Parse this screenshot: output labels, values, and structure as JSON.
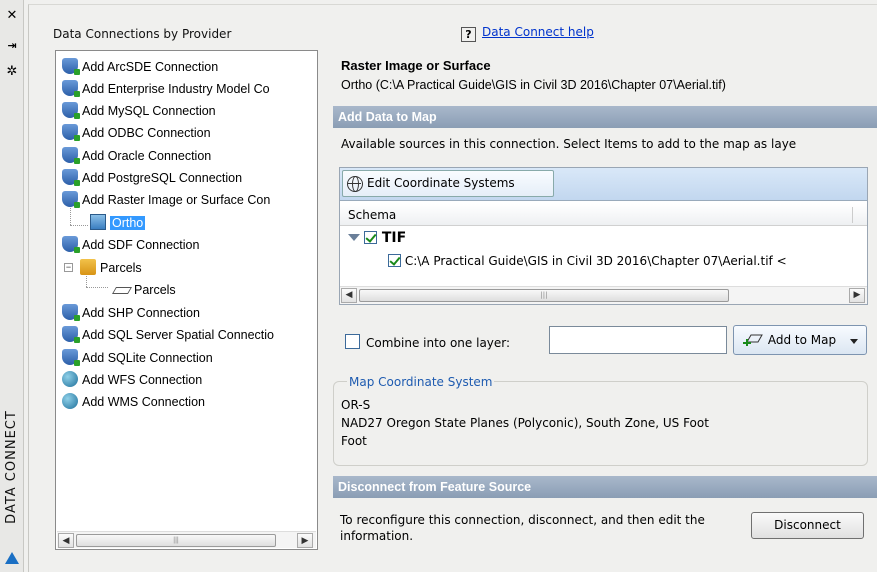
{
  "palette": {
    "title": "DATA CONNECT",
    "close_glyph": "✕",
    "pin_glyph": "⇥",
    "settings_glyph": "✲"
  },
  "left": {
    "header": "Data Connections by Provider",
    "tree": [
      {
        "label": "Add ArcSDE Connection",
        "icon": "database-icon"
      },
      {
        "label": "Add Enterprise Industry Model Co",
        "icon": "database-icon"
      },
      {
        "label": "Add MySQL Connection",
        "icon": "database-icon"
      },
      {
        "label": "Add ODBC Connection",
        "icon": "database-icon"
      },
      {
        "label": "Add Oracle Connection",
        "icon": "database-icon"
      },
      {
        "label": "Add PostgreSQL Connection",
        "icon": "database-icon"
      },
      {
        "label": "Add Raster Image or Surface Con",
        "icon": "database-icon"
      },
      {
        "label": "Ortho",
        "icon": "raster-icon",
        "selected": true
      },
      {
        "label": "Add SDF Connection",
        "icon": "database-icon"
      },
      {
        "label": "Parcels",
        "icon": "folder-icon"
      },
      {
        "label": "Parcels",
        "icon": "polygon-icon"
      },
      {
        "label": "Add SHP Connection",
        "icon": "database-icon"
      },
      {
        "label": "Add SQL Server Spatial Connectio",
        "icon": "database-icon"
      },
      {
        "label": "Add SQLite Connection",
        "icon": "database-icon"
      },
      {
        "label": "Add WFS Connection",
        "icon": "globe-icon"
      },
      {
        "label": "Add WMS Connection",
        "icon": "globe-icon"
      }
    ],
    "expander_glyph": "−"
  },
  "right": {
    "help_link": "Data Connect help",
    "help_glyph": "?",
    "connection_title": "Raster Image or Surface",
    "connection_path": "Ortho (C:\\A Practical Guide\\GIS in Civil 3D 2016\\Chapter 07\\Aerial.tif)",
    "add_data_header": "Add Data to Map",
    "available_text": "Available sources in this connection.  Select Items to add to the map as laye",
    "edit_cs_button": "Edit Coordinate Systems",
    "schema_header": "Schema",
    "schema_item": "TIF",
    "schema_file": "C:\\A Practical Guide\\GIS in Civil 3D 2016\\Chapter 07\\Aerial.tif   <",
    "combine_label": "Combine into one layer:",
    "combine_value": "",
    "add_to_map_button": "Add to Map",
    "map_cs_legend": "Map Coordinate System",
    "map_cs_lines": [
      "OR-S",
      "NAD27 Oregon State Planes (Polyconic), South Zone, US Foot",
      "Foot"
    ],
    "disconnect_header": "Disconnect from Feature Source",
    "disconnect_text": "To reconfigure this connection, disconnect, and then edit the information.",
    "disconnect_button": "Disconnect"
  },
  "scrollbar": {
    "left_arrow": "◀",
    "right_arrow": "▶",
    "grip": "|||"
  }
}
